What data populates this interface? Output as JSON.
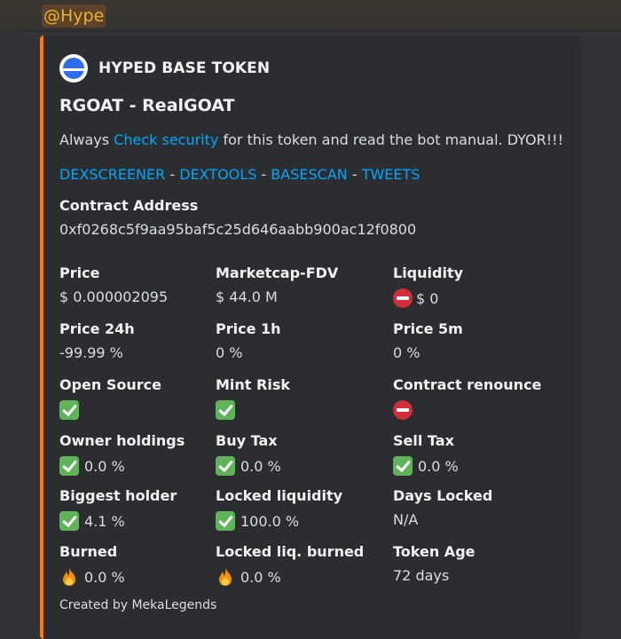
{
  "mention": "@Hype",
  "embed": {
    "accent_color": "#ff7a00",
    "author": "HYPED BASE TOKEN",
    "title": "RGOAT - RealGOAT",
    "description": {
      "before": "Always ",
      "link": "Check security",
      "after": " for this token and read the bot manual. DYOR!!!"
    },
    "links": [
      "DEXSCREENER",
      "DEXTOOLS",
      "BASESCAN",
      "TWEETS"
    ],
    "link_separator": " - ",
    "contract": {
      "label": "Contract Address",
      "value": "0xf0268c5f9aa95baf5c25d646aabb900ac12f0800"
    },
    "fields": [
      {
        "name": "Price",
        "value": "$ 0.000002095",
        "icon": ""
      },
      {
        "name": "Marketcap-FDV",
        "value": "$ 44.0 M",
        "icon": ""
      },
      {
        "name": "Liquidity",
        "value": "$ 0",
        "icon": "no-entry-icon"
      },
      {
        "name": "Price 24h",
        "value": "-99.99 %",
        "icon": ""
      },
      {
        "name": "Price 1h",
        "value": "0 %",
        "icon": ""
      },
      {
        "name": "Price 5m",
        "value": "0 %",
        "icon": ""
      },
      {
        "name": "Open Source",
        "value": "",
        "icon": "check-icon"
      },
      {
        "name": "Mint Risk",
        "value": "",
        "icon": "check-icon"
      },
      {
        "name": "Contract renounce",
        "value": "",
        "icon": "no-entry-icon"
      },
      {
        "name": "Owner holdings",
        "value": "0.0 %",
        "icon": "check-icon"
      },
      {
        "name": "Buy Tax",
        "value": "0.0 %",
        "icon": "check-icon"
      },
      {
        "name": "Sell Tax",
        "value": "0.0 %",
        "icon": "check-icon"
      },
      {
        "name": "Biggest holder",
        "value": "4.1 %",
        "icon": "check-icon"
      },
      {
        "name": "Locked liquidity",
        "value": "100.0 %",
        "icon": "check-icon"
      },
      {
        "name": "Days Locked",
        "value": "N/A",
        "icon": ""
      },
      {
        "name": "Burned",
        "value": "0.0 %",
        "icon": "fire-icon"
      },
      {
        "name": "Locked liq. burned",
        "value": "0.0 %",
        "icon": "fire-icon"
      },
      {
        "name": "Token Age",
        "value": "72 days",
        "icon": ""
      }
    ],
    "footer": "Created by MekaLegends"
  }
}
